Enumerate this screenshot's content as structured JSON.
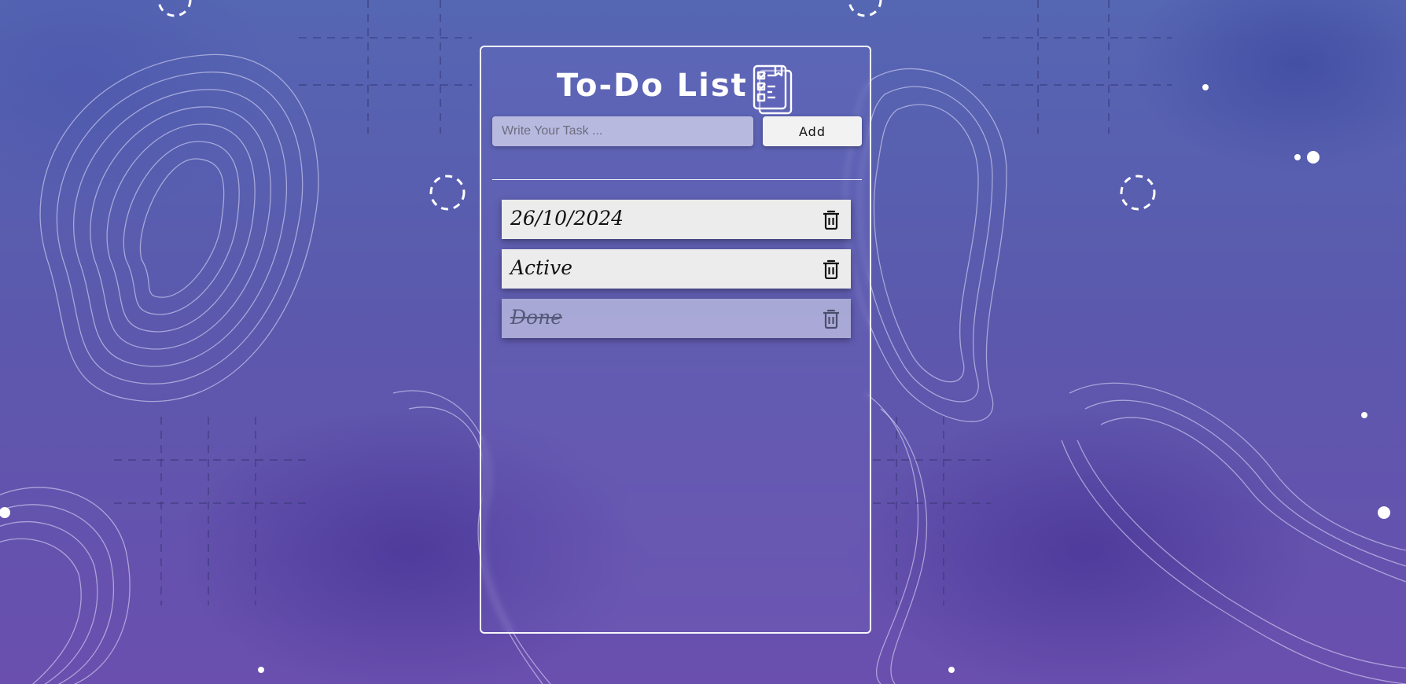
{
  "app": {
    "title": "To-Do List",
    "title_icon": "checklist-clipboard-icon"
  },
  "input": {
    "placeholder": "Write Your Task ...",
    "value": ""
  },
  "add_button": {
    "label": "Add"
  },
  "tasks": [
    {
      "text": "26/10/2024",
      "completed": false,
      "delete_icon": "trash-icon"
    },
    {
      "text": "Active",
      "completed": false,
      "delete_icon": "trash-icon"
    },
    {
      "text": "Done",
      "completed": true,
      "delete_icon": "trash-icon"
    }
  ],
  "colors": {
    "background_top": "#5566b3",
    "background_bottom": "#6a4fae",
    "card_border": "#ffffff",
    "task_bg": "#ececec",
    "task_done_bg": "#c8c8e6"
  }
}
